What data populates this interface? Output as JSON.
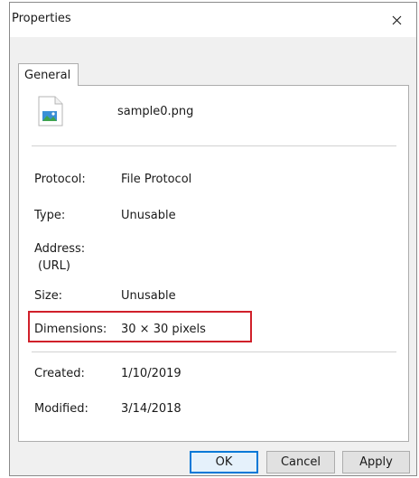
{
  "window": {
    "title": "Properties"
  },
  "tabs": [
    {
      "label": "General"
    }
  ],
  "file": {
    "name": "sample0.png"
  },
  "rows": [
    {
      "label": "Protocol:",
      "value": "File Protocol"
    },
    {
      "label": "Type:",
      "value": "Unusable"
    },
    {
      "label": "Address:",
      "label2": "(URL)",
      "value": ""
    },
    {
      "label": "Size:",
      "value": "Unusable"
    },
    {
      "label": "Dimensions:",
      "value": "30 × 30 pixels"
    },
    {
      "label": "Created:",
      "value": "1/10/2019"
    },
    {
      "label": "Modified:",
      "value": "3/14/2018"
    }
  ],
  "buttons": {
    "ok": "OK",
    "cancel": "Cancel",
    "apply": "Apply"
  },
  "icons": {
    "close": "close-icon",
    "file": "image-file-icon"
  },
  "colors": {
    "highlight": "#d0202a",
    "accent": "#0078d7"
  }
}
